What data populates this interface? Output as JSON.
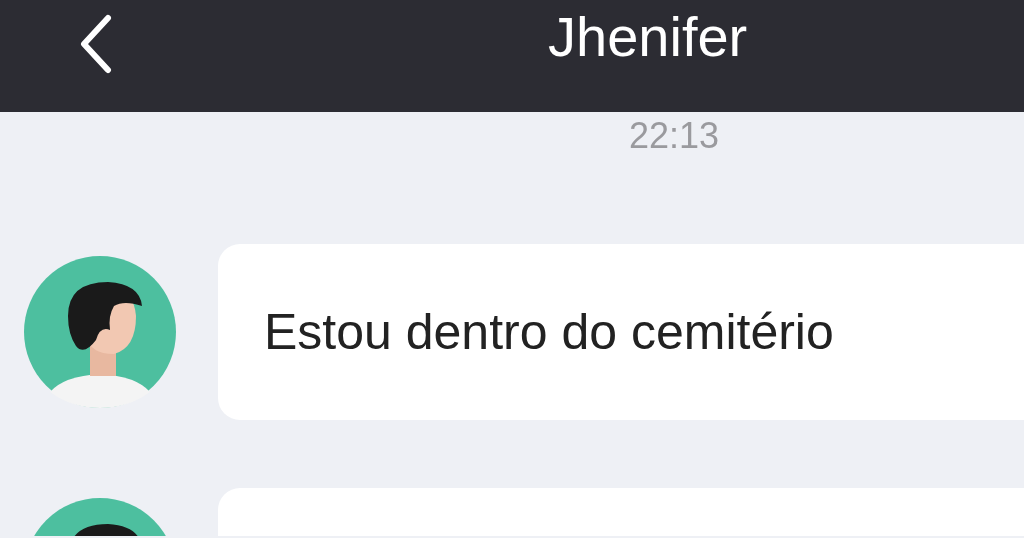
{
  "header": {
    "title": "Jhenifer"
  },
  "time": "22:13",
  "messages": [
    {
      "text": "Estou dentro do cemitério"
    }
  ],
  "more_below": true
}
